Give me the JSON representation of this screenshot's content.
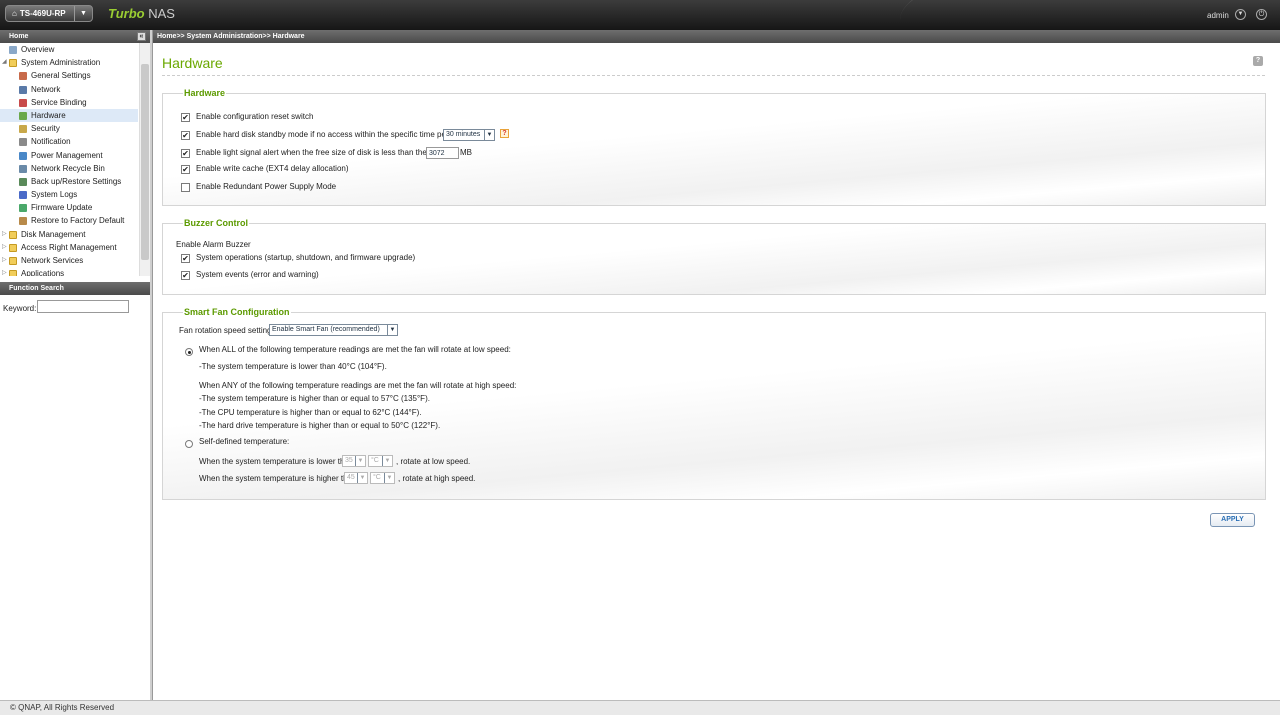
{
  "header": {
    "model": "TS-469U-RP",
    "brand_turbo": "Turbo",
    "brand_nas": "NAS",
    "user": "admin"
  },
  "sidebar": {
    "title": "Home",
    "items": [
      {
        "label": "Overview",
        "level": 0,
        "icon": "overview-icon"
      },
      {
        "label": "System Administration",
        "level": 0,
        "icon": "folder-icon",
        "expanded": true
      },
      {
        "label": "General Settings",
        "level": 1,
        "icon": "general-settings-icon"
      },
      {
        "label": "Network",
        "level": 1,
        "icon": "network-icon"
      },
      {
        "label": "Service Binding",
        "level": 1,
        "icon": "service-binding-icon"
      },
      {
        "label": "Hardware",
        "level": 1,
        "icon": "hardware-icon",
        "selected": true
      },
      {
        "label": "Security",
        "level": 1,
        "icon": "security-icon"
      },
      {
        "label": "Notification",
        "level": 1,
        "icon": "notification-icon"
      },
      {
        "label": "Power Management",
        "level": 1,
        "icon": "power-icon"
      },
      {
        "label": "Network Recycle Bin",
        "level": 1,
        "icon": "recycle-bin-icon"
      },
      {
        "label": "Back up/Restore Settings",
        "level": 1,
        "icon": "backup-icon"
      },
      {
        "label": "System Logs",
        "level": 1,
        "icon": "logs-icon"
      },
      {
        "label": "Firmware Update",
        "level": 1,
        "icon": "firmware-icon"
      },
      {
        "label": "Restore to Factory Default",
        "level": 1,
        "icon": "factory-default-icon"
      },
      {
        "label": "Disk Management",
        "level": 0,
        "icon": "folder-icon"
      },
      {
        "label": "Access Right Management",
        "level": 0,
        "icon": "folder-icon"
      },
      {
        "label": "Network Services",
        "level": 0,
        "icon": "folder-icon"
      },
      {
        "label": "Applications",
        "level": 0,
        "icon": "folder-icon"
      }
    ],
    "function_search_title": "Function Search",
    "keyword_label": "Keyword:",
    "keyword_value": ""
  },
  "breadcrumb": "Home>> System Administration>> Hardware",
  "page": {
    "title": "Hardware"
  },
  "hardware": {
    "title": "Hardware",
    "options": [
      {
        "label": "Enable configuration reset switch",
        "checked": true
      },
      {
        "label": "Enable hard disk standby mode if no access within the specific time period",
        "checked": true
      },
      {
        "label": "Enable light signal alert when the free size of disk is less than the value",
        "checked": true
      },
      {
        "label": "Enable write cache (EXT4 delay allocation)",
        "checked": true
      },
      {
        "label": "Enable Redundant Power Supply Mode",
        "checked": false
      }
    ],
    "standby_time": "30 minutes",
    "alert_value": "3072",
    "alert_unit": "MB"
  },
  "buzzer": {
    "title": "Buzzer Control",
    "enable_label": "Enable Alarm Buzzer",
    "options": [
      {
        "label": "System operations (startup, shutdown, and firmware upgrade)",
        "checked": true
      },
      {
        "label": "System events (error and warning)",
        "checked": true
      }
    ]
  },
  "fan": {
    "title": "Smart Fan Configuration",
    "speed_label": "Fan rotation speed settings:",
    "speed_value": "Enable Smart Fan (recommended)",
    "smart_low_heading": "When ALL of the following temperature readings are met the fan will rotate at low speed:",
    "smart_low_lines": [
      "-The system temperature is lower than 40°C (104°F)."
    ],
    "smart_high_heading": "When ANY of the following temperature readings are met the fan will rotate at high speed:",
    "smart_high_lines": [
      "-The system temperature is higher than or equal to 57°C (135°F).",
      "-The CPU temperature is higher than or equal to 62°C (144°F).",
      "-The hard drive temperature is higher than or equal to 50°C (122°F)."
    ],
    "self_defined_label": "Self-defined temperature:",
    "low_prefix": "When the system temperature is lower than",
    "low_value": "35",
    "low_unit": "°C",
    "low_suffix": ", rotate at low speed.",
    "high_prefix": "When the system temperature is higher than",
    "high_value": "45",
    "high_unit": "°C",
    "high_suffix": ", rotate at high speed."
  },
  "apply_label": "APPLY",
  "footer": "© QNAP, All Rights Reserved"
}
